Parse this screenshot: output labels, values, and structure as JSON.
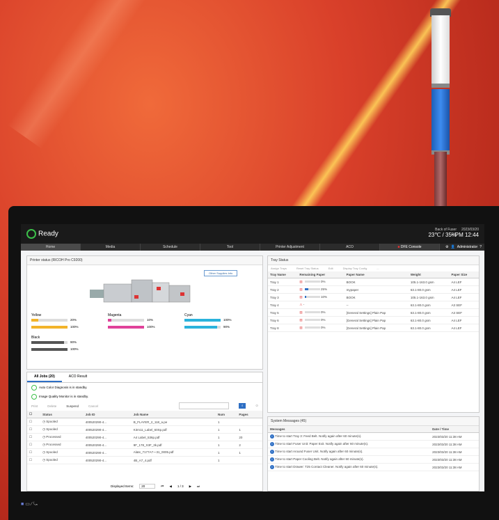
{
  "status": {
    "label": "Ready"
  },
  "env": {
    "title": "Back of Fuser",
    "temp_humidity": "23℃ / 35%",
    "date": "2023/03/20",
    "time": "PM 12:44"
  },
  "tabs": [
    "Home",
    "Media",
    "Schedule",
    "Tool",
    "Printer Adjustment",
    "ACO",
    "DFE Console"
  ],
  "user": {
    "name": "Administrator"
  },
  "printer_status": {
    "title": "Printer status (RICOH Pro C9200)",
    "other_supplies_button": "Other Supplies Info",
    "supplies": [
      {
        "name": "Yellow",
        "level_pct": 20,
        "label": "20%",
        "color": "#f2b42a",
        "group": 0,
        "row": 0
      },
      {
        "name": "",
        "level_pct": 100,
        "label": "100%",
        "color": "#f2b42a",
        "group": 0,
        "row": 1
      },
      {
        "name": "Magenta",
        "level_pct": 10,
        "label": "10%",
        "color": "#e0429a",
        "group": 1,
        "row": 0
      },
      {
        "name": "",
        "level_pct": 100,
        "label": "100%",
        "color": "#e0429a",
        "group": 1,
        "row": 1
      },
      {
        "name": "Cyan",
        "level_pct": 100,
        "label": "100%",
        "color": "#2bb3dc",
        "group": 2,
        "row": 0
      },
      {
        "name": "",
        "level_pct": 90,
        "label": "90%",
        "color": "#2bb3dc",
        "group": 2,
        "row": 1
      },
      {
        "name": "Black",
        "level_pct": 90,
        "label": "90%",
        "color": "#555555",
        "group": 0,
        "row": 2
      },
      {
        "name": "",
        "level_pct": 100,
        "label": "100%",
        "color": "#555555",
        "group": 0,
        "row": 3
      }
    ]
  },
  "tray_status": {
    "title": "Tray Status",
    "toolbar": [
      "Assign Trays",
      "Reset Tray Status",
      "Edit",
      "Display Tray Config",
      "..."
    ],
    "columns": [
      "Tray Name",
      "Remaining Paper",
      "Paper Name",
      "Weight",
      "Paper Size"
    ],
    "rows": [
      [
        "Tray 1",
        "0%",
        "BOOK",
        "105.1-163.0 gsm",
        "A4 LEF"
      ],
      [
        "Tray 2",
        "25%",
        "mypaper",
        "63.1-80.0 gsm",
        "A4 LEF"
      ],
      [
        "Tray 3",
        "10%",
        "BOOK",
        "105.1-163.0 gsm",
        "A4 LEF"
      ],
      [
        "Tray 4",
        "-",
        "--",
        "63.1-80.0 gsm",
        "A3 SEF"
      ],
      [
        "Tray 5",
        "0%",
        "[General Settings] Plain Pap",
        "63.1-80.0 gsm",
        "A3 SEF"
      ],
      [
        "Tray 6",
        "0%",
        "[General Settings] Plain Pap",
        "63.1-80.0 gsm",
        "A4 LEF"
      ],
      [
        "Tray 8",
        "0%",
        "[General Settings] Plain Pap",
        "63.1-80.0 gsm",
        "A4 LEF"
      ]
    ],
    "fills": [
      0,
      25,
      10,
      0,
      0,
      0,
      0
    ]
  },
  "jobs": {
    "tabs": [
      "All Jobs (20)",
      "ACO Result"
    ],
    "notices": [
      "Auto Color Diagnosis is in standby.",
      "Image Quality Monitor is in standby."
    ],
    "toolbar": [
      "Print",
      "Delete",
      "Suspend",
      "Cancel"
    ],
    "columns": [
      "Status",
      "Job ID",
      "Job Name",
      "Num",
      "Pages"
    ],
    "rows": [
      [
        "Spooled",
        "400520290-4...",
        "B_FLAYER_2_118_a.pe",
        "1",
        ""
      ],
      [
        "Spooled",
        "400520290-4...",
        "K3m11_Label_60Sp.pdf",
        "1",
        "1"
      ],
      [
        "Processed",
        "400520290-4...",
        "A4 Label_536p.pdf",
        "1",
        "20"
      ],
      [
        "Processed",
        "400520290-4...",
        "9F_178_X3F_3k.pdf",
        "1",
        "2"
      ],
      [
        "Spooled",
        "400520290-4...",
        "Alate_7177A7ー31_0005.pdf",
        "1",
        "1"
      ],
      [
        "Spooled",
        "400520290-4...",
        "4B_A7_4.pdf",
        "1",
        ""
      ]
    ],
    "footer": {
      "displayed_label": "Displayed Items:",
      "displayed_value": "20",
      "page": "1 / 3"
    }
  },
  "messages": {
    "title": "System Messages (45)",
    "columns": [
      "Messages",
      "Date / Time"
    ],
    "rows": [
      [
        "Time to start Tray 3: Feed Belt. Notify again after 60 minute(s).",
        "2023/03/20 11:38 AM"
      ],
      [
        "Time to start Fuser Unit: Paper Exit. Notify again after 60 minute(s).",
        "2023/03/20 11:38 AM"
      ],
      [
        "Time to start Around Fuser Unit. Notify again after 60 minute(s).",
        "2023/03/20 11:38 AM"
      ],
      [
        "Time to start Paper Cooling Belt. Notify again after 60 minute(s).",
        "2023/03/20 11:38 AM"
      ],
      [
        "Time to start Drawer: T25 Contact Cleaner. Notify again after 60 minute(s).",
        "2023/03/20 11:38 AM"
      ]
    ]
  }
}
